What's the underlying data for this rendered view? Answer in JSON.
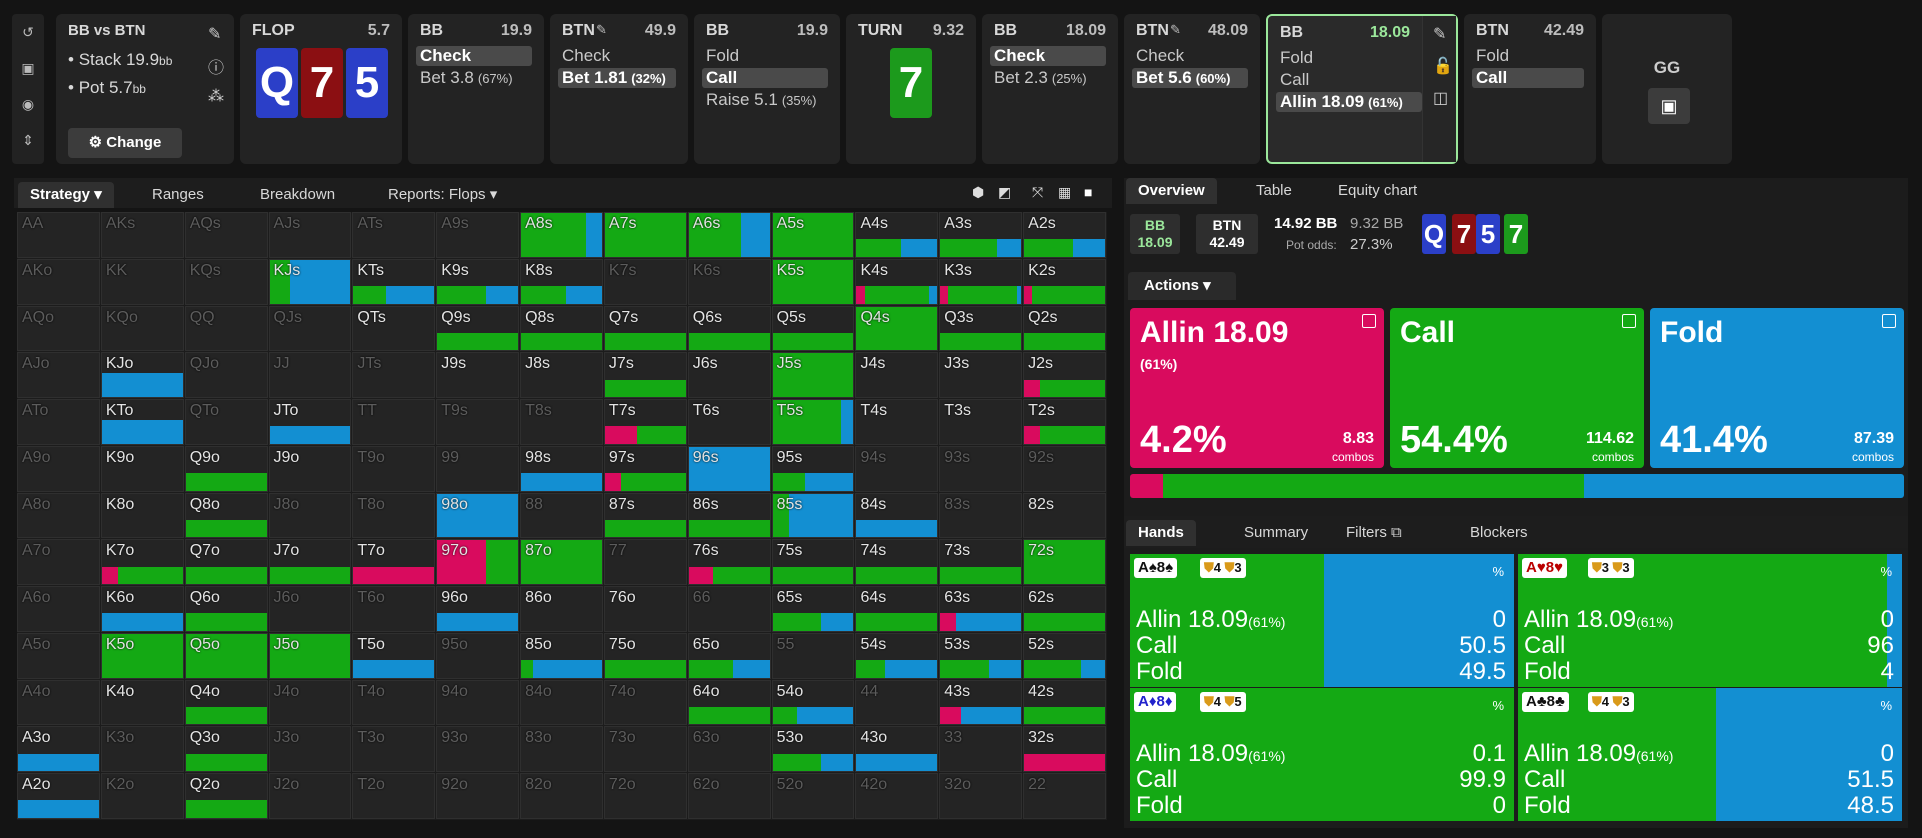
{
  "colors": {
    "allin": "#d90b5e",
    "call": "#14a914",
    "fold": "#138fd2",
    "bg": "#141414"
  },
  "sidebar_icons": [
    "undo-icon",
    "save-icon",
    "gamepad-icon",
    "collapse-icon"
  ],
  "header": {
    "title": "BB vs BTN",
    "stack_label": "Stack",
    "stack_val": "19.9",
    "stack_unit": "bb",
    "pot_label": "Pot",
    "pot_val": "5.7",
    "pot_unit": "bb",
    "change_label": "Change"
  },
  "flop": {
    "title": "FLOP",
    "value": "5.7",
    "cards": [
      "Q",
      "7",
      "5"
    ]
  },
  "nodes": [
    {
      "player": "BB",
      "value": "19.9",
      "options": [
        "Check",
        "Bet 3.8"
      ],
      "pcts": [
        "",
        "(67%)"
      ],
      "sel": 0
    },
    {
      "player": "BTN",
      "value": "49.9",
      "options": [
        "Check",
        "Bet 1.81"
      ],
      "pcts": [
        "",
        "(32%)"
      ],
      "sel": 1
    },
    {
      "player": "BB",
      "value": "19.9",
      "options": [
        "Fold",
        "Call",
        "Raise 5.1"
      ],
      "pcts": [
        "",
        "",
        "(35%)"
      ],
      "sel": 1
    },
    {
      "player": "BB",
      "value": "18.09",
      "options": [
        "Check",
        "Bet 2.3"
      ],
      "pcts": [
        "",
        "(25%)"
      ],
      "sel": 0
    },
    {
      "player": "BTN",
      "value": "48.09",
      "options": [
        "Check",
        "Bet 5.6"
      ],
      "pcts": [
        "",
        "(60%)"
      ],
      "sel": 1
    },
    {
      "player": "BB",
      "value": "18.09",
      "options": [
        "Fold",
        "Call",
        "Allin 18.09"
      ],
      "pcts": [
        "",
        "",
        "(61%)"
      ],
      "sel": 2
    },
    {
      "player": "BTN",
      "value": "42.49",
      "options": [
        "Fold",
        "Call"
      ],
      "pcts": [
        "",
        ""
      ],
      "sel": 1
    }
  ],
  "turn": {
    "title": "TURN",
    "value": "9.32",
    "card": "7"
  },
  "gg": {
    "label": "GG"
  },
  "left_tabs": [
    "Strategy",
    "Ranges",
    "Breakdown",
    "Reports: Flops"
  ],
  "grid": [
    [
      "AA",
      "AKs",
      "AQs",
      "AJs",
      "ATs",
      "A9s",
      "A8s",
      "A7s",
      "A6s",
      "A5s",
      "A4s",
      "A3s",
      "A2s"
    ],
    [
      "AKo",
      "KK",
      "KQs",
      "KJs",
      "KTs",
      "K9s",
      "K8s",
      "K7s",
      "K6s",
      "K5s",
      "K4s",
      "K3s",
      "K2s"
    ],
    [
      "AQo",
      "KQo",
      "QQ",
      "QJs",
      "QTs",
      "Q9s",
      "Q8s",
      "Q7s",
      "Q6s",
      "Q5s",
      "Q4s",
      "Q3s",
      "Q2s"
    ],
    [
      "AJo",
      "KJo",
      "QJo",
      "JJ",
      "JTs",
      "J9s",
      "J8s",
      "J7s",
      "J6s",
      "J5s",
      "J4s",
      "J3s",
      "J2s"
    ],
    [
      "ATo",
      "KTo",
      "QTo",
      "JTo",
      "TT",
      "T9s",
      "T8s",
      "T7s",
      "T6s",
      "T5s",
      "T4s",
      "T3s",
      "T2s"
    ],
    [
      "A9o",
      "K9o",
      "Q9o",
      "J9o",
      "T9o",
      "99",
      "98s",
      "97s",
      "96s",
      "95s",
      "94s",
      "93s",
      "92s"
    ],
    [
      "A8o",
      "K8o",
      "Q8o",
      "J8o",
      "T8o",
      "98o",
      "88",
      "87s",
      "86s",
      "85s",
      "84s",
      "83s",
      "82s"
    ],
    [
      "A7o",
      "K7o",
      "Q7o",
      "J7o",
      "T7o",
      "97o",
      "87o",
      "77",
      "76s",
      "75s",
      "74s",
      "73s",
      "72s"
    ],
    [
      "A6o",
      "K6o",
      "Q6o",
      "J6o",
      "T6o",
      "96o",
      "86o",
      "76o",
      "66",
      "65s",
      "64s",
      "63s",
      "62s"
    ],
    [
      "A5o",
      "K5o",
      "Q5o",
      "J5o",
      "T5o",
      "95o",
      "85o",
      "75o",
      "65o",
      "55",
      "54s",
      "53s",
      "52s"
    ],
    [
      "A4o",
      "K4o",
      "Q4o",
      "J4o",
      "T4o",
      "94o",
      "84o",
      "74o",
      "64o",
      "54o",
      "44",
      "43s",
      "42s"
    ],
    [
      "A3o",
      "K3o",
      "Q3o",
      "J3o",
      "T3o",
      "93o",
      "83o",
      "73o",
      "63o",
      "53o",
      "43o",
      "33",
      "32s"
    ],
    [
      "A2o",
      "K2o",
      "Q2o",
      "J2o",
      "T2o",
      "92o",
      "82o",
      "72o",
      "62o",
      "52o",
      "42o",
      "32o",
      "22"
    ]
  ],
  "right_tabs": [
    "Overview",
    "Table",
    "Equity chart"
  ],
  "pot_info": {
    "p1": "BB",
    "v1": "18.09",
    "p2": "BTN",
    "v2": "42.49",
    "pot": "14.92 BB",
    "pot2": "9.32 BB",
    "odds_label": "Pot odds:",
    "odds": "27.3%",
    "board": [
      "Q",
      "7",
      "5",
      "7"
    ]
  },
  "actions_label": "Actions",
  "actions": [
    {
      "name": "Allin 18.09",
      "sub": "(61%)",
      "pct": "4.2%",
      "combos": "8.83",
      "combos_label": "combos"
    },
    {
      "name": "Call",
      "sub": "",
      "pct": "54.4%",
      "combos": "114.62",
      "combos_label": "combos"
    },
    {
      "name": "Fold",
      "sub": "",
      "pct": "41.4%",
      "combos": "87.39",
      "combos_label": "combos"
    }
  ],
  "action_freqs": [
    4.2,
    54.4,
    41.4
  ],
  "hand_tabs": [
    "Hands",
    "Summary",
    "Filters",
    "Blockers"
  ],
  "hands": [
    {
      "cards": "A♠8♠",
      "b1": "4",
      "b2": "3",
      "allin": "0",
      "call": "50.5",
      "fold": "49.5",
      "red": false
    },
    {
      "cards": "A♥8♥",
      "b1": "3",
      "b2": "3",
      "allin": "0",
      "call": "96",
      "fold": "4",
      "red": true
    },
    {
      "cards": "A♦8♦",
      "b1": "4",
      "b2": "5",
      "allin": "0.1",
      "call": "99.9",
      "fold": "0",
      "red": false
    },
    {
      "cards": "A♣8♣",
      "b1": "4",
      "b2": "3",
      "allin": "0",
      "call": "51.5",
      "fold": "48.5",
      "red": false
    }
  ],
  "hand_labels": {
    "allin": "Allin 18.09",
    "allin_pct": "(61%)",
    "call": "Call",
    "fold": "Fold",
    "pct": "%"
  }
}
